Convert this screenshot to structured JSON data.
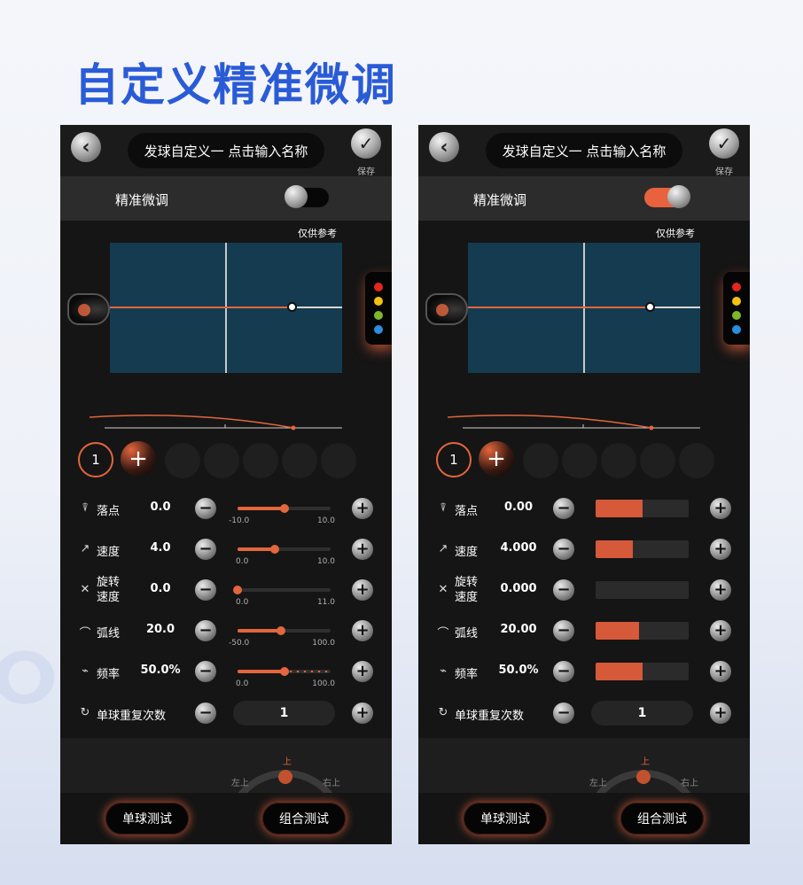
{
  "page_title": "自定义精准微调",
  "colors": {
    "accent": "#e3663d",
    "title_blue": "#2a5bd7",
    "table": "#153b50"
  },
  "panels": [
    {
      "header": {
        "back_icon": "chevron-left-icon",
        "name": "发球自定义一 点击输入名称",
        "save_icon": "check-icon",
        "save_label": "保存"
      },
      "fine_tune": {
        "label": "精准微调",
        "enabled": false
      },
      "reference_label": "仅供参考",
      "ball_selector": {
        "current": "1",
        "add": "+"
      },
      "rows": [
        {
          "label": "落点",
          "value": "0.0",
          "min": "-10.0",
          "max": "10.0",
          "fraction": 0.5
        },
        {
          "label": "速度",
          "value": "4.0",
          "min": "0.0",
          "max": "10.0",
          "fraction": 0.4
        },
        {
          "label": "旋转\n速度",
          "value": "0.0",
          "min": "0.0",
          "max": "11.0",
          "fraction": 0.0
        },
        {
          "label": "弧线",
          "value": "20.0",
          "min": "-50.0",
          "max": "100.0",
          "fraction": 0.47
        },
        {
          "label": "频率",
          "value": "50.0%",
          "min": "0.0",
          "max": "100.0",
          "fraction": 0.5
        }
      ],
      "repeat": {
        "label": "单球重复次数",
        "value": "1"
      },
      "spin": {
        "top": "上",
        "left": "左上",
        "right": "右上"
      },
      "buttons": {
        "single": "单球测试",
        "combo": "组合测试"
      }
    },
    {
      "header": {
        "back_icon": "chevron-left-icon",
        "name": "发球自定义一 点击输入名称",
        "save_icon": "check-icon",
        "save_label": "保存"
      },
      "fine_tune": {
        "label": "精准微调",
        "enabled": true
      },
      "reference_label": "仅供参考",
      "ball_selector": {
        "current": "1",
        "add": "+"
      },
      "rows": [
        {
          "label": "落点",
          "value": "0.00",
          "fraction": 0.5
        },
        {
          "label": "速度",
          "value": "4.000",
          "fraction": 0.4
        },
        {
          "label": "旋转\n速度",
          "value": "0.000",
          "fraction": 0.0
        },
        {
          "label": "弧线",
          "value": "20.00",
          "fraction": 0.47
        },
        {
          "label": "频率",
          "value": "50.0%",
          "fraction": 0.5
        }
      ],
      "repeat": {
        "label": "单球重复次数",
        "value": "1"
      },
      "spin": {
        "top": "上",
        "left": "左上",
        "right": "右上"
      },
      "buttons": {
        "single": "单球测试",
        "combo": "组合测试"
      }
    }
  ]
}
